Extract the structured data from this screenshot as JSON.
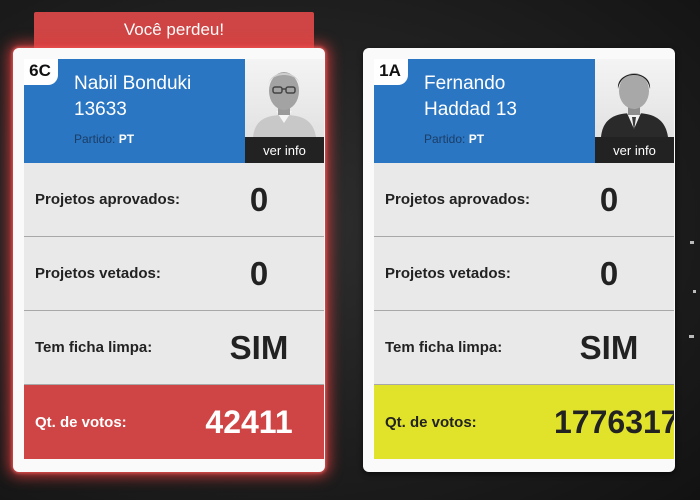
{
  "result_banner": "Você perdeu!",
  "cards": [
    {
      "number": "6C",
      "name_line1": "Nabil Bonduki",
      "name_line2": "13633",
      "party_label": "Partido:",
      "party": "PT",
      "info_button": "ver info",
      "stats": [
        {
          "label": "Projetos aprovados:",
          "value": "0"
        },
        {
          "label": "Projetos vetados:",
          "value": "0"
        },
        {
          "label": "Tem ficha limpa:",
          "value": "SIM"
        }
      ],
      "votes_label": "Qt. de votos:",
      "votes": "42411"
    },
    {
      "number": "1A",
      "name_line1": "Fernando",
      "name_line2": "Haddad 13",
      "party_label": "Partido:",
      "party": "PT",
      "info_button": "ver info",
      "stats": [
        {
          "label": "Projetos aprovados:",
          "value": "0"
        },
        {
          "label": "Projetos vetados:",
          "value": "0"
        },
        {
          "label": "Tem ficha limpa:",
          "value": "SIM"
        }
      ],
      "votes_label": "Qt. de votos:",
      "votes": "1776317"
    }
  ],
  "colors": {
    "header_blue": "#2a76c2",
    "loser_red": "#cf4545",
    "winner_yellow": "#e1e32a"
  }
}
